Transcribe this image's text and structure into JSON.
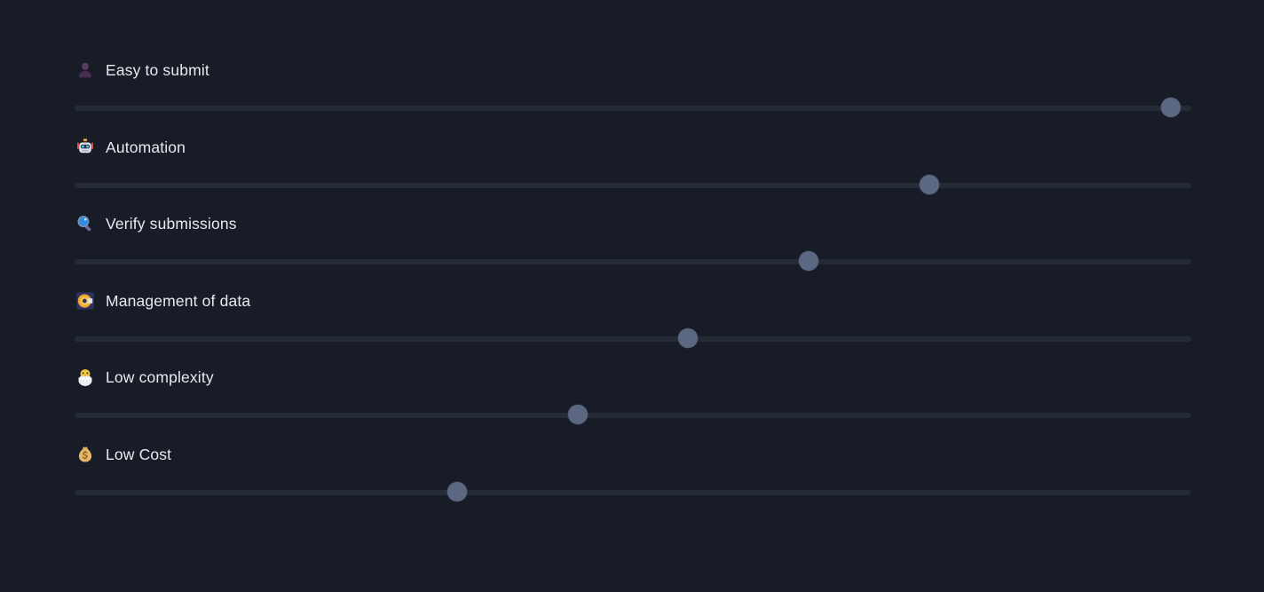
{
  "page": {
    "background_color": "#181c26",
    "track_color": "#252a37",
    "thumb_color": "#5c6781",
    "label_color": "#e6e9f0"
  },
  "sliders": [
    {
      "id": "easy-to-submit",
      "icon": "bust-in-silhouette-icon",
      "icon_emoji": "👤",
      "label": "Easy to submit",
      "value": 99,
      "min": 0,
      "max": 100
    },
    {
      "id": "automation",
      "icon": "robot-icon",
      "icon_emoji": "🤖",
      "label": "Automation",
      "value": 77,
      "min": 0,
      "max": 100
    },
    {
      "id": "verify-submissions",
      "icon": "magnifying-glass-icon",
      "icon_emoji": "🔍",
      "label": "Verify submissions",
      "value": 66,
      "min": 0,
      "max": 100
    },
    {
      "id": "management-of-data",
      "icon": "computer-disk-icon",
      "icon_emoji": "💽",
      "label": "Management of data",
      "value": 55,
      "min": 0,
      "max": 100
    },
    {
      "id": "low-complexity",
      "icon": "hatching-chick-icon",
      "icon_emoji": "🐣",
      "label": "Low complexity",
      "value": 45,
      "min": 0,
      "max": 100
    },
    {
      "id": "low-cost",
      "icon": "money-bag-icon",
      "icon_emoji": "💰",
      "label": "Low Cost",
      "value": 34,
      "min": 0,
      "max": 100
    }
  ]
}
